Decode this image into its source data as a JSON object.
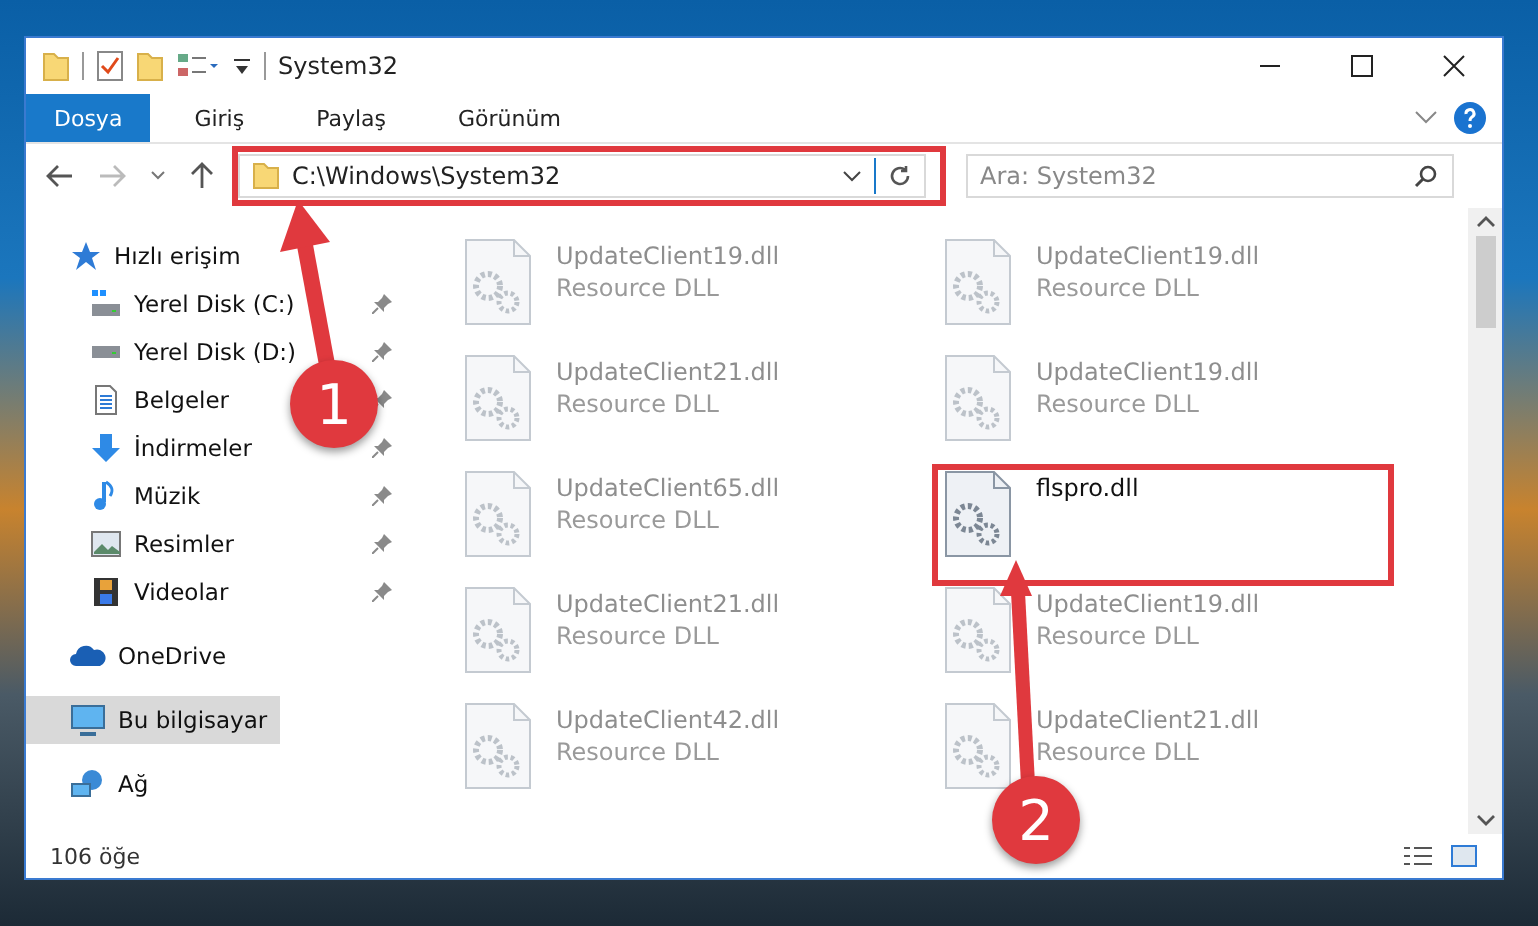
{
  "window": {
    "title": "System32"
  },
  "tabs": [
    {
      "label": "Dosya",
      "selected": true
    },
    {
      "label": "Giriş",
      "selected": false
    },
    {
      "label": "Paylaş",
      "selected": false
    },
    {
      "label": "Görünüm",
      "selected": false
    }
  ],
  "address": {
    "path": "C:\\Windows\\System32"
  },
  "search": {
    "placeholder": "Ara: System32"
  },
  "sidebar": {
    "items": [
      {
        "label": "Hızlı erişim",
        "selected": false,
        "children": [
          {
            "label": "Yerel Disk (C:)",
            "pinned": true,
            "selected": false
          },
          {
            "label": "Yerel Disk (D:)",
            "pinned": true,
            "selected": false
          },
          {
            "label": "Belgeler",
            "pinned": true,
            "selected": false
          },
          {
            "label": "İndirmeler",
            "pinned": true,
            "selected": false
          },
          {
            "label": "Müzik",
            "pinned": true,
            "selected": false
          },
          {
            "label": "Resimler",
            "pinned": true,
            "selected": false
          },
          {
            "label": "Videolar",
            "pinned": true,
            "selected": false
          }
        ]
      },
      {
        "label": "OneDrive",
        "selected": false
      },
      {
        "label": "Bu bilgisayar",
        "selected": true
      },
      {
        "label": "Ağ",
        "selected": false
      }
    ]
  },
  "files": [
    {
      "name": "UpdateClient19.dll",
      "type": "Resource DLL",
      "blurred": true
    },
    {
      "name": "UpdateClient19.dll",
      "type": "Resource DLL",
      "blurred": true
    },
    {
      "name": "UpdateClient21.dll",
      "type": "Resource DLL",
      "blurred": true
    },
    {
      "name": "UpdateClient19.dll",
      "type": "Resource DLL",
      "blurred": true
    },
    {
      "name": "UpdateClient65.dll",
      "type": "Resource DLL",
      "blurred": true
    },
    {
      "name": "flspro.dll",
      "blurred": false
    },
    {
      "name": "UpdateClient21.dll",
      "type": "Resource DLL",
      "blurred": true
    },
    {
      "name": "UpdateClient19.dll",
      "type": "Resource DLL",
      "blurred": true
    },
    {
      "name": "UpdateClient42.dll",
      "type": "Resource DLL",
      "blurred": true
    },
    {
      "name": "UpdateClient21.dll",
      "type": "Resource DLL",
      "blurred": true
    }
  ],
  "status_bar": {
    "count": "106 öğe"
  },
  "callouts": [
    {
      "number": "1"
    },
    {
      "number": "2"
    }
  ]
}
